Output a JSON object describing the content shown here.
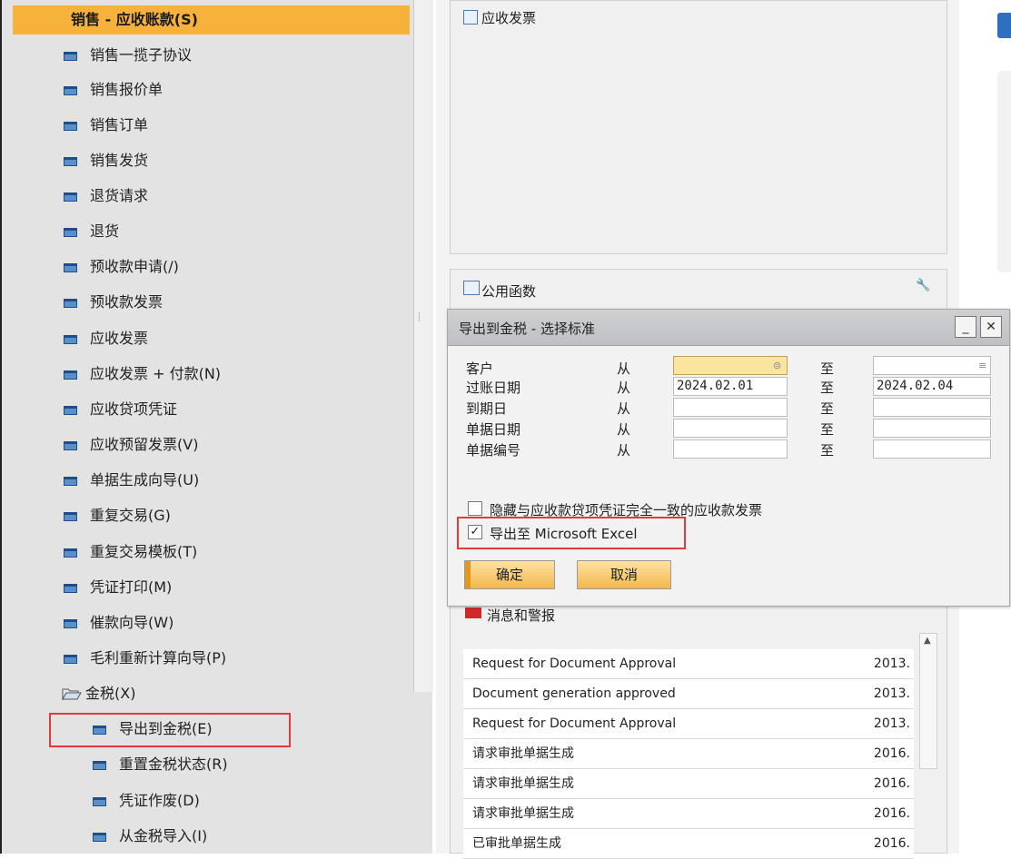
{
  "menu": {
    "header": "销售 - 应收账款(S)",
    "items": [
      "销售一揽子协议",
      "销售报价单",
      "销售订单",
      "销售发货",
      "退货请求",
      "退货",
      "预收款申请(/)",
      "预收款发票",
      "应收发票",
      "应收发票 + 付款(N)",
      "应收贷项凭证",
      "应收预留发票(V)",
      "单据生成向导(U)",
      "重复交易(G)",
      "重复交易模板(T)",
      "凭证打印(M)",
      "催款向导(W)",
      "毛利重新计算向导(P)"
    ],
    "folder": "金税(X)",
    "subitems": [
      "导出到金税(E)",
      "重置金税状态(R)",
      "凭证作废(D)",
      "从金税导入(I)"
    ]
  },
  "panels": {
    "invoice_title": "应收发票",
    "func_title": "公用函数",
    "msg_title": "消息和警报"
  },
  "messages": [
    {
      "text": "Request for Document Approval",
      "date": "2013."
    },
    {
      "text": "Document generation approved",
      "date": "2013."
    },
    {
      "text": "Request for Document Approval",
      "date": "2013."
    },
    {
      "text": "请求审批单据生成",
      "date": "2016."
    },
    {
      "text": "请求审批单据生成",
      "date": "2016."
    },
    {
      "text": "请求审批单据生成",
      "date": "2016."
    },
    {
      "text": "已审批单据生成",
      "date": "2016."
    }
  ],
  "dialog": {
    "title": "导出到金税 - 选择标准",
    "from_label": "从",
    "to_label": "至",
    "criteria": [
      {
        "label": "客户",
        "from": "",
        "to": ""
      },
      {
        "label": "过账日期",
        "from": "2024.02.01",
        "to": "2024.02.04"
      },
      {
        "label": "到期日",
        "from": "",
        "to": ""
      },
      {
        "label": "单据日期",
        "from": "",
        "to": ""
      },
      {
        "label": "单据编号",
        "from": "",
        "to": ""
      }
    ],
    "checkbox_hide": {
      "label": "隐藏与应收款贷项凭证完全一致的应收款发票",
      "checked": false
    },
    "checkbox_excel": {
      "label": "导出至 Microsoft Excel",
      "checked": true
    },
    "ok_label": "确定",
    "cancel_label": "取消",
    "minimize_glyph": "_",
    "close_glyph": "✕"
  },
  "colors": {
    "header_orange": "#f7b23b",
    "highlight_red": "#e03a3a",
    "active_field": "#fbe3a0"
  }
}
